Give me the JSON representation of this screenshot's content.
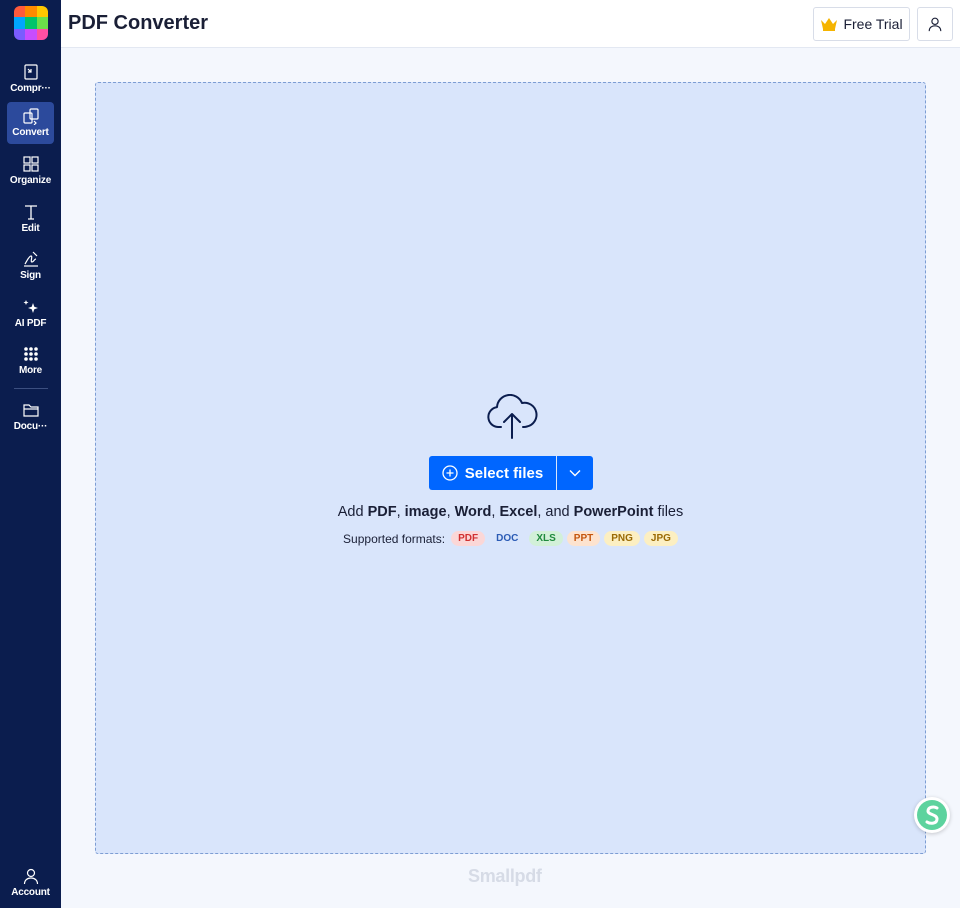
{
  "sidebar": {
    "items": [
      {
        "label": "Compr···",
        "icon": "compress-icon"
      },
      {
        "label": "Convert",
        "icon": "convert-icon"
      },
      {
        "label": "Organize",
        "icon": "organize-icon"
      },
      {
        "label": "Edit",
        "icon": "edit-text-icon"
      },
      {
        "label": "Sign",
        "icon": "signature-icon"
      },
      {
        "label": "AI PDF",
        "icon": "sparkle-icon"
      },
      {
        "label": "More",
        "icon": "grid-dots-icon"
      },
      {
        "label": "Docu···",
        "icon": "folder-icon"
      }
    ],
    "account_label": "Account",
    "active": "Convert"
  },
  "header": {
    "title": "PDF Converter",
    "trial_label": "Free Trial"
  },
  "dropzone": {
    "select_label": "Select files",
    "add_prefix": "Add ",
    "add_pdf": "PDF",
    "sep1": ", ",
    "add_image": "image",
    "sep2": ", ",
    "add_word": "Word",
    "sep3": ", ",
    "add_excel": "Excel",
    "sep4": ", and ",
    "add_ppt": "PowerPoint",
    "add_suffix": " files",
    "formats_label": "Supported formats:",
    "formats": [
      {
        "label": "PDF",
        "bg": "#fbd7d7",
        "fg": "#d03030"
      },
      {
        "label": "DOC",
        "bg": "#d9e5fb",
        "fg": "#2b5bb5"
      },
      {
        "label": "XLS",
        "bg": "#d2f0d8",
        "fg": "#1f8a3d"
      },
      {
        "label": "PPT",
        "bg": "#fde3cf",
        "fg": "#c4560e"
      },
      {
        "label": "PNG",
        "bg": "#fcefc2",
        "fg": "#9a6a05"
      },
      {
        "label": "JPG",
        "bg": "#fcefc2",
        "fg": "#9a6a05"
      }
    ]
  },
  "footer": {
    "brand": "Smallpdf"
  },
  "colors": {
    "sidebar_bg": "#0b1d4e",
    "accent": "#0066ff",
    "dropzone_bg": "#d9e5fb"
  }
}
